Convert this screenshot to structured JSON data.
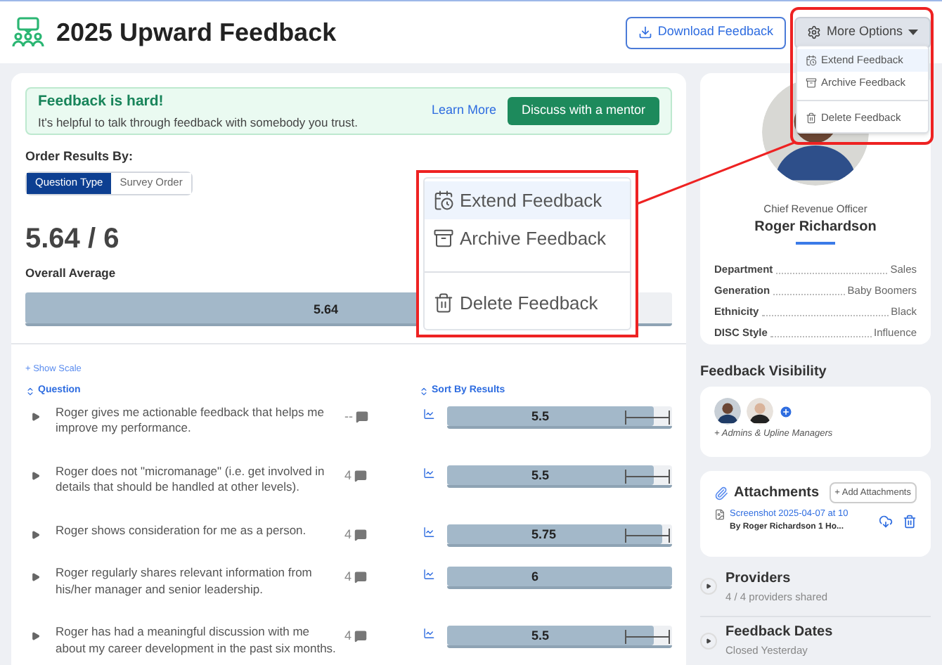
{
  "header": {
    "title": "2025 Upward Feedback",
    "download_button": "Download Feedback",
    "more_options_button": "More Options"
  },
  "dropdown": {
    "items": [
      {
        "label": "Extend Feedback",
        "kind": "extend",
        "highlighted": true
      },
      {
        "label": "Archive Feedback",
        "kind": "archive",
        "highlighted": false
      },
      {
        "label": "Delete Feedback",
        "kind": "delete",
        "highlighted": false
      }
    ]
  },
  "callout": {
    "items": [
      {
        "label": "Extend Feedback",
        "kind": "extend",
        "highlighted": true
      },
      {
        "label": "Archive Feedback",
        "kind": "archive",
        "highlighted": false
      },
      {
        "label": "Delete Feedback",
        "kind": "delete",
        "highlighted": false
      }
    ]
  },
  "banner": {
    "title": "Feedback is hard!",
    "text": "It's helpful to talk through feedback with somebody you trust.",
    "link": "Learn More",
    "button": "Discuss with a mentor"
  },
  "order": {
    "label": "Order Results By:",
    "options": [
      {
        "label": "Question Type",
        "selected": true
      },
      {
        "label": "Survey Order",
        "selected": false
      }
    ]
  },
  "score": {
    "value": "5.64 / 6",
    "label": "Overall Average",
    "reading": "5.64",
    "level": 0.94
  },
  "show_scale": "+ Show Scale",
  "columns": {
    "question": "Question",
    "sort": "Sort By Results"
  },
  "questions": [
    {
      "text": "Roger gives me actionable feedback that helps me improve my performance.",
      "comments": "--",
      "reading": "5.5",
      "level": 0.917,
      "range": true
    },
    {
      "text": "Roger does not \"micromanage\" (i.e. get involved in details that should be handled at other levels).",
      "comments": "4",
      "reading": "5.5",
      "level": 0.917,
      "range": true
    },
    {
      "text": "Roger shows consideration for me as a person.",
      "comments": "4",
      "reading": "5.75",
      "level": 0.958,
      "range": true
    },
    {
      "text": "Roger regularly shares relevant information from his/her manager and senior leadership.",
      "comments": "4",
      "reading": "6",
      "level": 1,
      "range": false
    },
    {
      "text": "Roger has had a meaningful discussion with me about my career development in the past six months.",
      "comments": "4",
      "reading": "5.5",
      "level": 0.917,
      "range": true
    }
  ],
  "profile": {
    "role": "Chief Revenue Officer",
    "name": "Roger Richardson",
    "fields": [
      {
        "label": "Department",
        "value": "Sales"
      },
      {
        "label": "Generation",
        "value": "Baby Boomers"
      },
      {
        "label": "Ethnicity",
        "value": "Black"
      },
      {
        "label": "DISC Style",
        "value": "Influence"
      }
    ]
  },
  "visibility": {
    "title": "Feedback Visibility",
    "note": "+ Admins & Upline Managers"
  },
  "attachments": {
    "title": "Attachments",
    "add_button": "+ Add Attachments",
    "files": [
      {
        "name": "Screenshot 2025-04-07 at 10",
        "meta": "By Roger Richardson 1 Ho..."
      }
    ]
  },
  "sections": [
    {
      "title": "Providers",
      "subtitle": "4 / 4 providers shared"
    },
    {
      "title": "Feedback Dates",
      "subtitle": "Closed Yesterday"
    }
  ]
}
